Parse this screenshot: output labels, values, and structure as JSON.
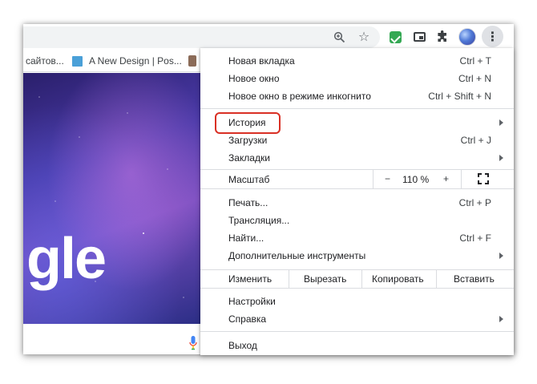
{
  "toolbar": {
    "icons": [
      "zoom-icon",
      "star-icon",
      "extension-green-icon",
      "picture-in-picture-icon",
      "puzzle-icon",
      "avatar",
      "kebab-menu-icon"
    ]
  },
  "bookmarks": {
    "item1": "сайтов...",
    "item2": "A New Design | Pos..."
  },
  "page": {
    "logo_fragment": "gle"
  },
  "menu": {
    "new_tab": {
      "label": "Новая вкладка",
      "shortcut": "Ctrl + T"
    },
    "new_window": {
      "label": "Новое окно",
      "shortcut": "Ctrl + N"
    },
    "incognito": {
      "label": "Новое окно в режиме инкогнито",
      "shortcut": "Ctrl + Shift + N"
    },
    "history": {
      "label": "История"
    },
    "downloads": {
      "label": "Загрузки",
      "shortcut": "Ctrl + J"
    },
    "bookmarks": {
      "label": "Закладки"
    },
    "zoom": {
      "label": "Масштаб",
      "minus": "−",
      "value": "110 %",
      "plus": "+"
    },
    "print": {
      "label": "Печать...",
      "shortcut": "Ctrl + P"
    },
    "cast": {
      "label": "Трансляция..."
    },
    "find": {
      "label": "Найти...",
      "shortcut": "Ctrl + F"
    },
    "more_tools": {
      "label": "Дополнительные инструменты"
    },
    "edit": {
      "label": "Изменить",
      "cut": "Вырезать",
      "copy": "Копировать",
      "paste": "Вставить"
    },
    "settings": {
      "label": "Настройки"
    },
    "help": {
      "label": "Справка"
    },
    "exit": {
      "label": "Выход"
    }
  },
  "colors": {
    "highlight": "#d93025",
    "accent_blue": "#4285f4"
  }
}
